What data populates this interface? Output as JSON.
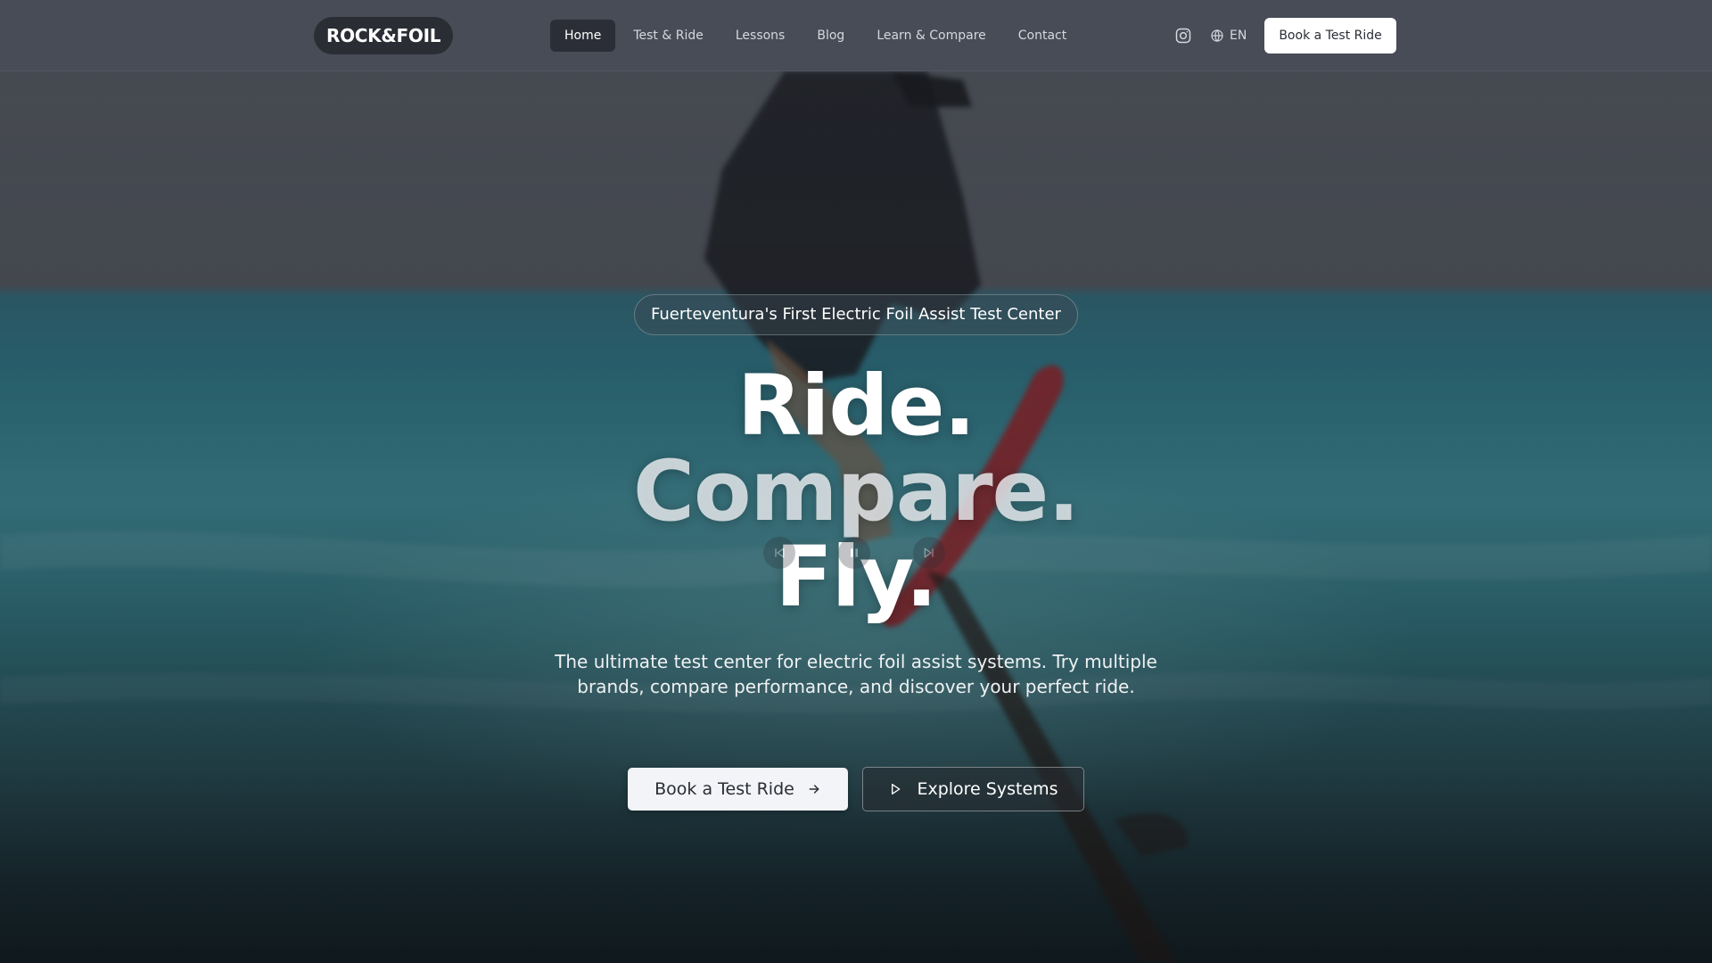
{
  "nav": {
    "logo": "ROCK&FOIL",
    "links": [
      {
        "label": "Home",
        "active": true
      },
      {
        "label": "Test & Ride",
        "active": false
      },
      {
        "label": "Lessons",
        "active": false
      },
      {
        "label": "Blog",
        "active": false
      },
      {
        "label": "Learn & Compare",
        "active": false
      },
      {
        "label": "Contact",
        "active": false
      }
    ],
    "instagram_icon": "instagram-icon",
    "language_icon": "globe-icon",
    "language": "EN",
    "book_button": "Book a Test Ride"
  },
  "hero": {
    "badge": "Fuerteventura's First Electric Foil Assist Test Center",
    "headline": [
      "Ride.",
      "Compare.",
      "Fly."
    ],
    "subtitle": "The ultimate test center for electric foil assist systems. Try multiple brands, compare performance, and discover your perfect ride.",
    "primary_cta": "Book a Test Ride",
    "secondary_cta": "Explore Systems",
    "carousel_icons": [
      "skip-back-icon",
      "pause-icon",
      "skip-forward-icon"
    ]
  },
  "colors": {
    "nav_bg": "#484c56",
    "active_link_bg": "#2b2e36",
    "button_bg": "#ffffff",
    "text_dark": "#2a2d34"
  }
}
